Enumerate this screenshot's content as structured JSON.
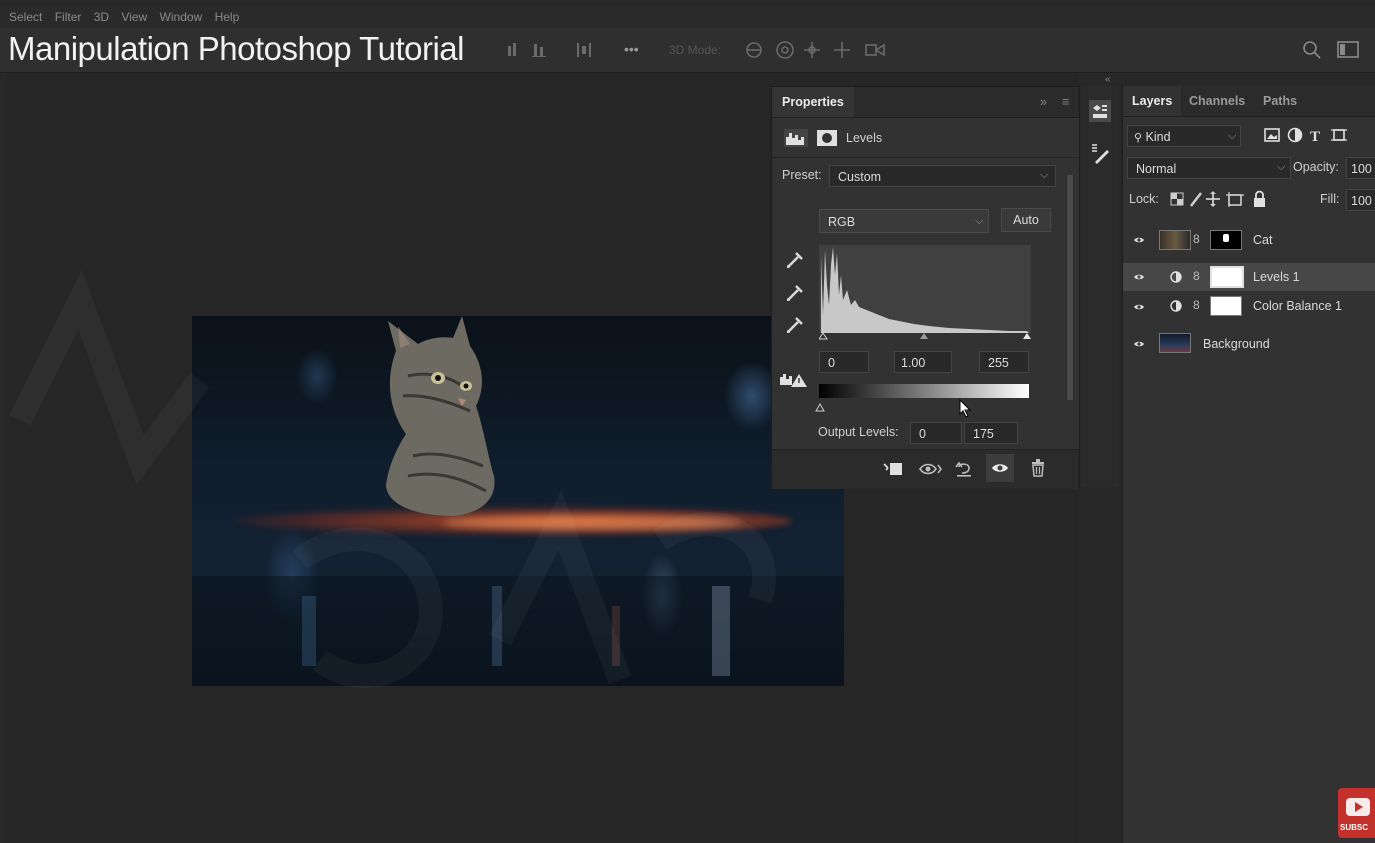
{
  "menu": [
    "Select",
    "Filter",
    "3D",
    "View",
    "Window",
    "Help"
  ],
  "overlay_title": "Manipulation Photoshop Tutorial",
  "options_bar": {
    "more": "•••",
    "mode_label": "3D Mode:"
  },
  "properties": {
    "tab_label": "Properties",
    "adjustment_name": "Levels",
    "preset_label": "Preset:",
    "preset_value": "Custom",
    "channel_value": "RGB",
    "auto_label": "Auto",
    "input_black": "0",
    "input_gamma": "1.00",
    "input_white": "255",
    "output_label": "Output Levels:",
    "output_black": "0",
    "output_white": "175"
  },
  "layers_panel": {
    "tabs": [
      "Layers",
      "Channels",
      "Paths"
    ],
    "filter_label": "Kind",
    "blend_mode": "Normal",
    "opacity_label": "Opacity:",
    "opacity_value": "100",
    "lock_label": "Lock:",
    "fill_label": "Fill:",
    "fill_value": "100",
    "layers": [
      {
        "name": "Cat",
        "type": "pixel-with-mask"
      },
      {
        "name": "Levels 1",
        "type": "adjustment",
        "selected": true
      },
      {
        "name": "Color Balance 1",
        "type": "adjustment"
      },
      {
        "name": "Background",
        "type": "pixel"
      }
    ]
  },
  "youtube_badge": "SUBSC",
  "colors": {
    "panel": "#323232",
    "canvas": "#262626",
    "selected_layer": "#474747"
  }
}
